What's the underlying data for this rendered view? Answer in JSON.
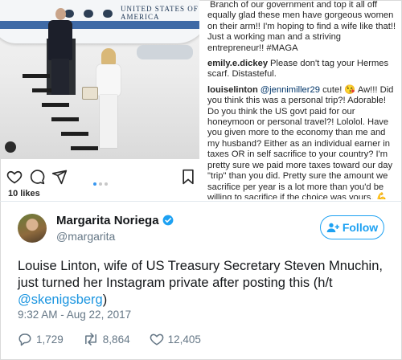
{
  "instagram": {
    "plane_text": "UNITED STATES OF AMERICA",
    "likes": "10 likes",
    "carousel": {
      "count": 3,
      "active_index": 0
    },
    "comments": [
      {
        "user": "",
        "mention": "",
        "text": "Branch of our government and top it all off equally glad these men have gorgeous women on their arm!! I'm hoping to find a wife like that!! Just a working man and a striving entrepreneur!! #MAGA"
      },
      {
        "user": "emily.e.dickey",
        "mention": "",
        "text": "Please don't tag your Hermes scarf. Distasteful."
      },
      {
        "user": "louiselinton",
        "mention": "@jennimiller29",
        "text": "cute! 😘 Aw!!! Did you think this was a personal trip?! Adorable! Do you think the US govt paid for our honeymoon or personal travel?! Lololol. Have you given more to the economy than me and my husband? Either as an individual earner in taxes OR in self sacrifice to your country? I'm pretty sure we paid more taxes toward our day \"trip\" than you did. Pretty sure the amount we sacrifice per year is a lot more than you'd be willing to sacrifice if the choice was yours. 💪😘 You're adorably out of touch. 😊 Thanks for the passive aggressive nasty comment. Your kids look very cute. Your life looks cute. I know you're mad but deep down you're really nice and so am I. Sending"
      }
    ]
  },
  "tweet": {
    "name": "Margarita Noriega",
    "handle": "@margarita",
    "follow_label": "Follow",
    "text_before": "Louise Linton, wife of US Treasury Secretary Steven Mnuchin, just turned her Instagram private after posting this (h/t ",
    "mention": "@skenigsberg",
    "text_after": ")",
    "timestamp": "9:32 AM - Aug 22, 2017",
    "replies": "1,729",
    "retweets": "8,864",
    "likes": "12,405"
  },
  "colors": {
    "twitter_blue": "#1da1f2",
    "muted": "#657786",
    "instagram_link": "#003569"
  },
  "icons": [
    "heart-icon",
    "comment-icon",
    "share-icon",
    "bookmark-icon",
    "verified-icon",
    "follow-person-icon",
    "reply-icon",
    "retweet-icon",
    "like-icon"
  ]
}
